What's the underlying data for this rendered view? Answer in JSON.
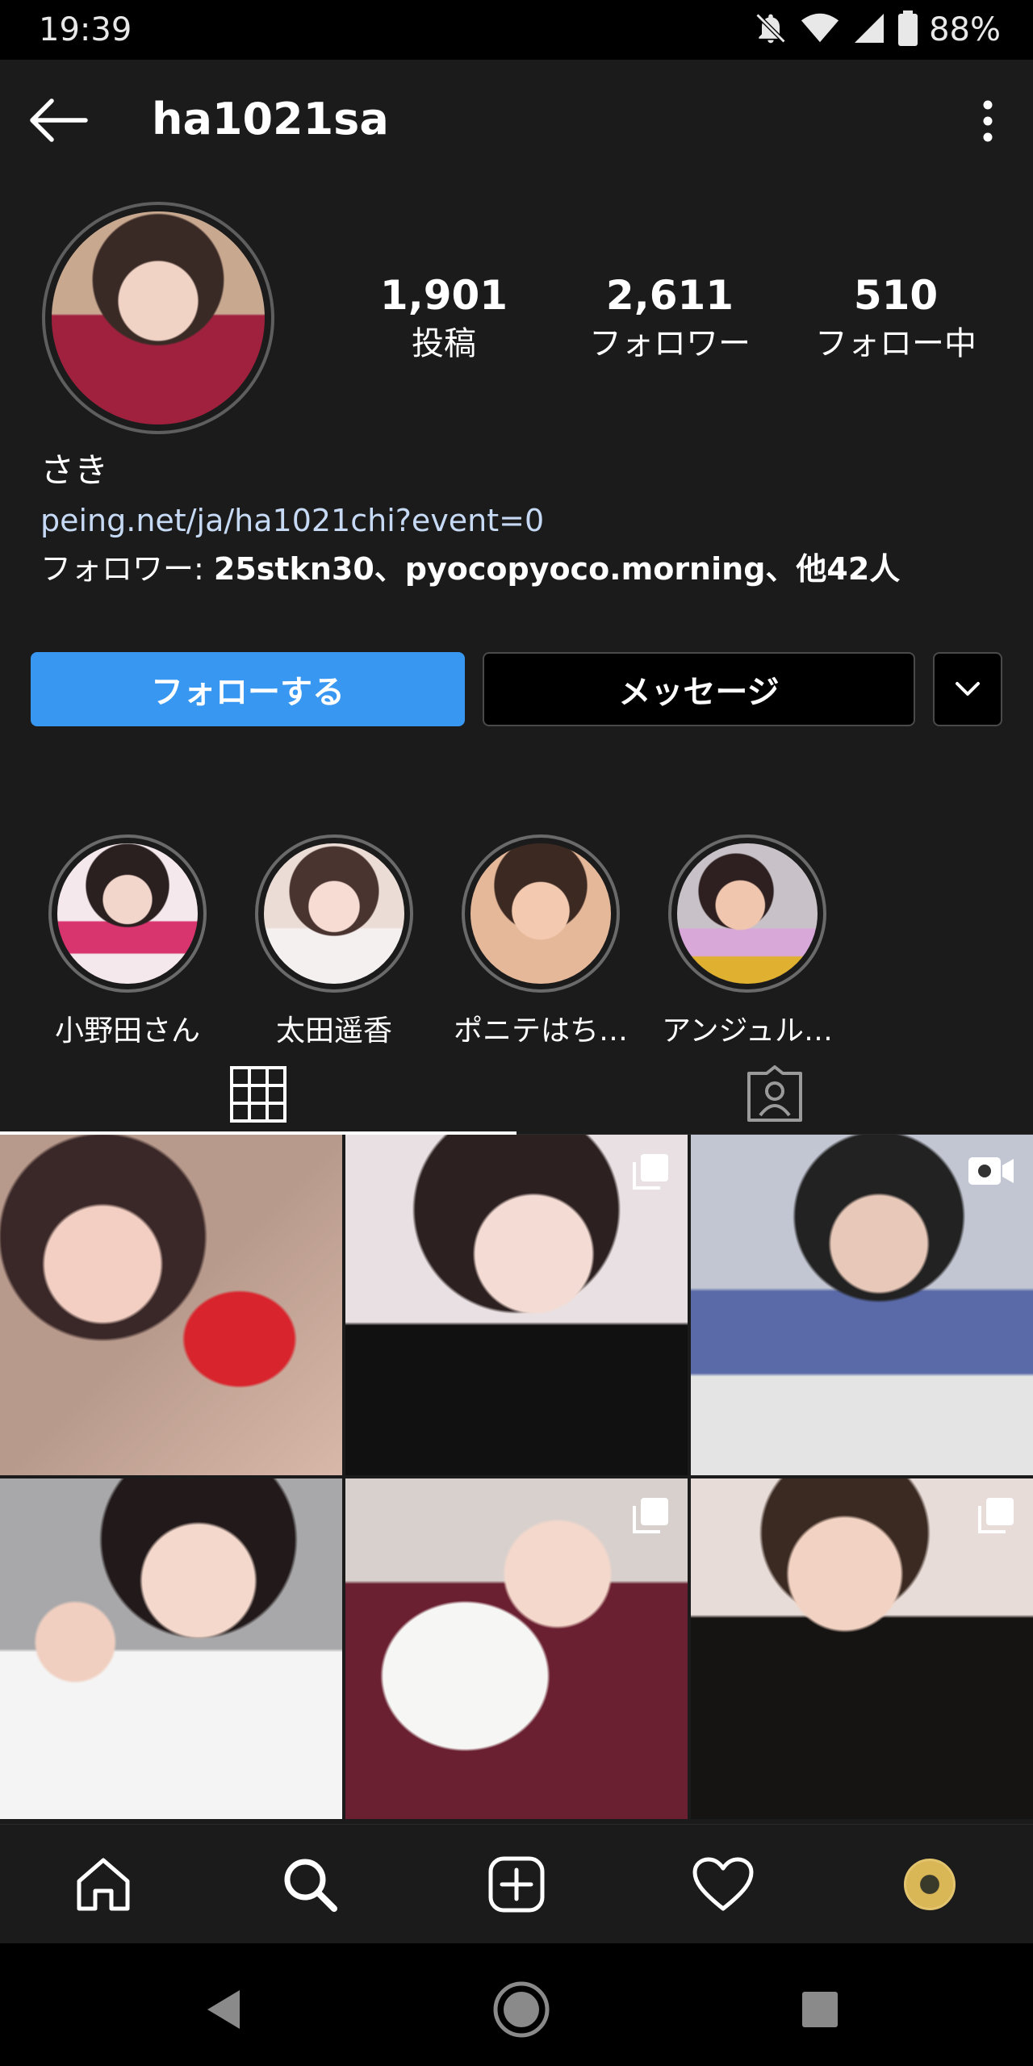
{
  "status_bar": {
    "time": "19:39",
    "battery": "88%"
  },
  "header": {
    "username": "ha1021sa"
  },
  "profile": {
    "stats": [
      {
        "value": "1,901",
        "label": "投稿"
      },
      {
        "value": "2,611",
        "label": "フォロワー"
      },
      {
        "value": "510",
        "label": "フォロー中"
      }
    ],
    "name": "さき",
    "link": "peing.net/ja/ha1021chi?event=0",
    "followed_by_prefix": "フォロワー: ",
    "followed_by_users": "25stkn30、pyocopyoco.morning",
    "followed_by_suffix": "、他42人"
  },
  "actions": {
    "follow_label": "フォローする",
    "message_label": "メッセージ"
  },
  "highlights": [
    {
      "label": "小野田さん"
    },
    {
      "label": "太田遥香"
    },
    {
      "label": "ポニテはち…"
    },
    {
      "label": "アンジュル…"
    }
  ],
  "tabs": {
    "active": "grid",
    "icons": [
      "grid-icon",
      "tagged-icon"
    ]
  },
  "posts": [
    {
      "type": "photo"
    },
    {
      "type": "carousel"
    },
    {
      "type": "video"
    },
    {
      "type": "photo"
    },
    {
      "type": "carousel"
    },
    {
      "type": "carousel"
    }
  ],
  "colors": {
    "accent": "#3897f0",
    "background": "#1b1b1c",
    "link": "#c7daf5"
  }
}
